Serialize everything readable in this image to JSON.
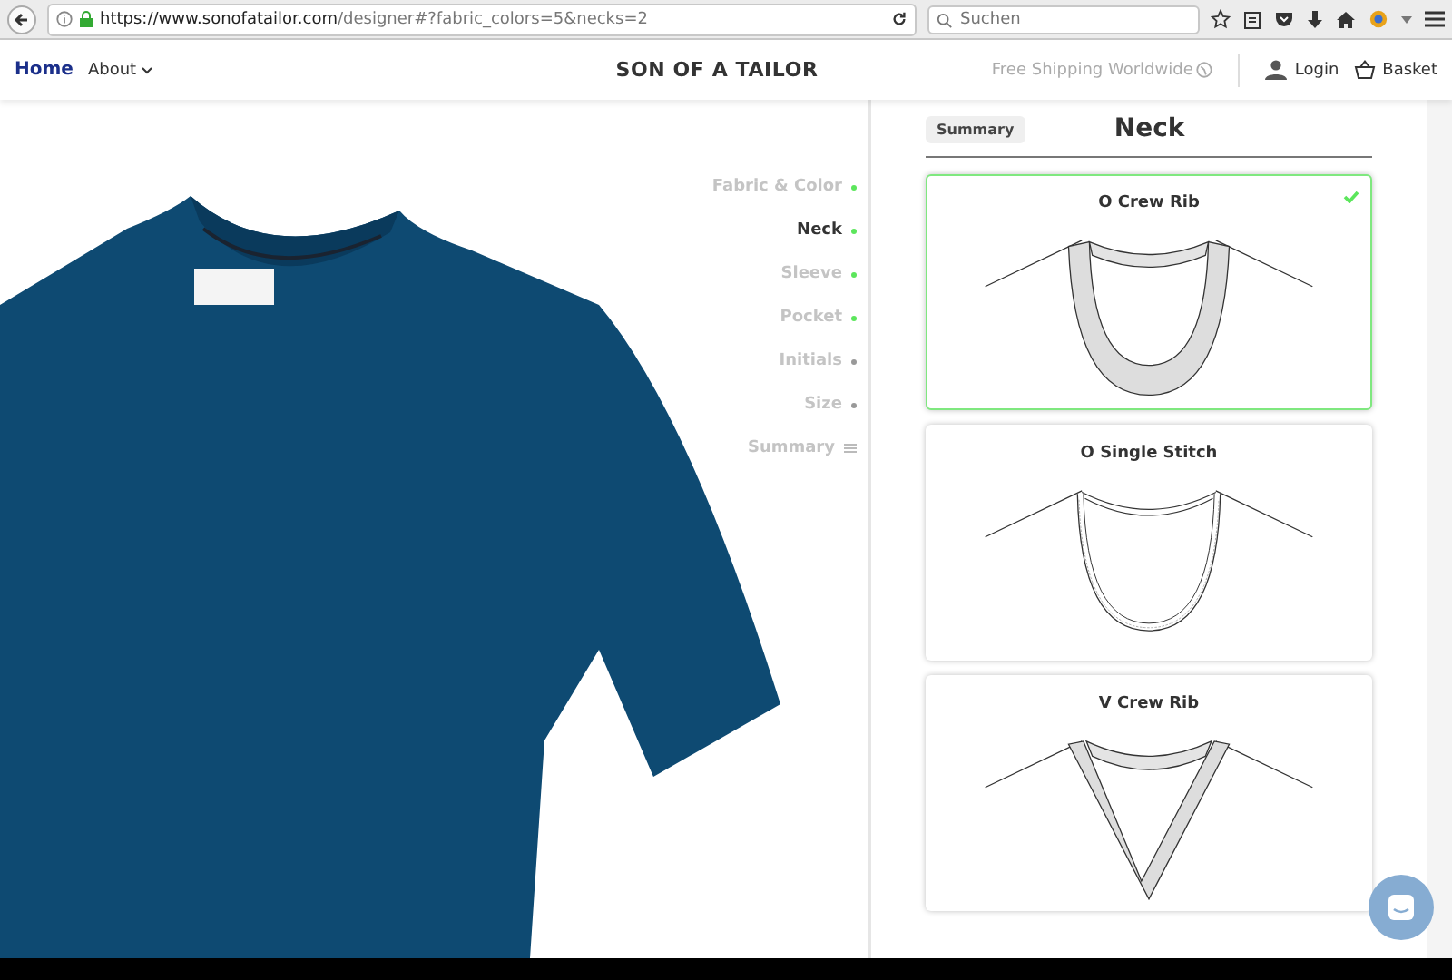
{
  "browser": {
    "url_host": "https://www.sonofatailor.com",
    "url_path": "/designer#?fabric_colors=5&necks=2",
    "search": {
      "placeholder": "Suchen"
    }
  },
  "nav": {
    "links": [
      {
        "label": "Home",
        "selected": true
      },
      {
        "label": "About",
        "selected": false
      }
    ],
    "brand": "SON OF A TAILOR",
    "shipping": "Free Shipping Worldwide",
    "login": "Login",
    "basket": "Basket"
  },
  "steps": [
    {
      "label": "Fabric & Color",
      "kind": "step",
      "selected": false,
      "done": true
    },
    {
      "label": "Neck",
      "kind": "step",
      "selected": true,
      "done": true
    },
    {
      "label": "Sleeve",
      "kind": "step",
      "selected": false,
      "done": true
    },
    {
      "label": "Pocket",
      "kind": "step",
      "selected": false,
      "done": true
    },
    {
      "label": "Initials",
      "kind": "step",
      "selected": false,
      "done": false
    },
    {
      "label": "Size",
      "kind": "step",
      "selected": false,
      "done": false
    },
    {
      "label": "Summary",
      "kind": "summary",
      "selected": false,
      "done": false
    }
  ],
  "panel": {
    "summary_button": "Summary",
    "title": "Neck",
    "options": [
      {
        "name": "O Crew Rib",
        "kind": "o-rib",
        "selected": true
      },
      {
        "name": "O Single Stitch",
        "kind": "o-stitch",
        "selected": false
      },
      {
        "name": "V Crew Rib",
        "kind": "v-rib",
        "selected": false
      }
    ]
  }
}
